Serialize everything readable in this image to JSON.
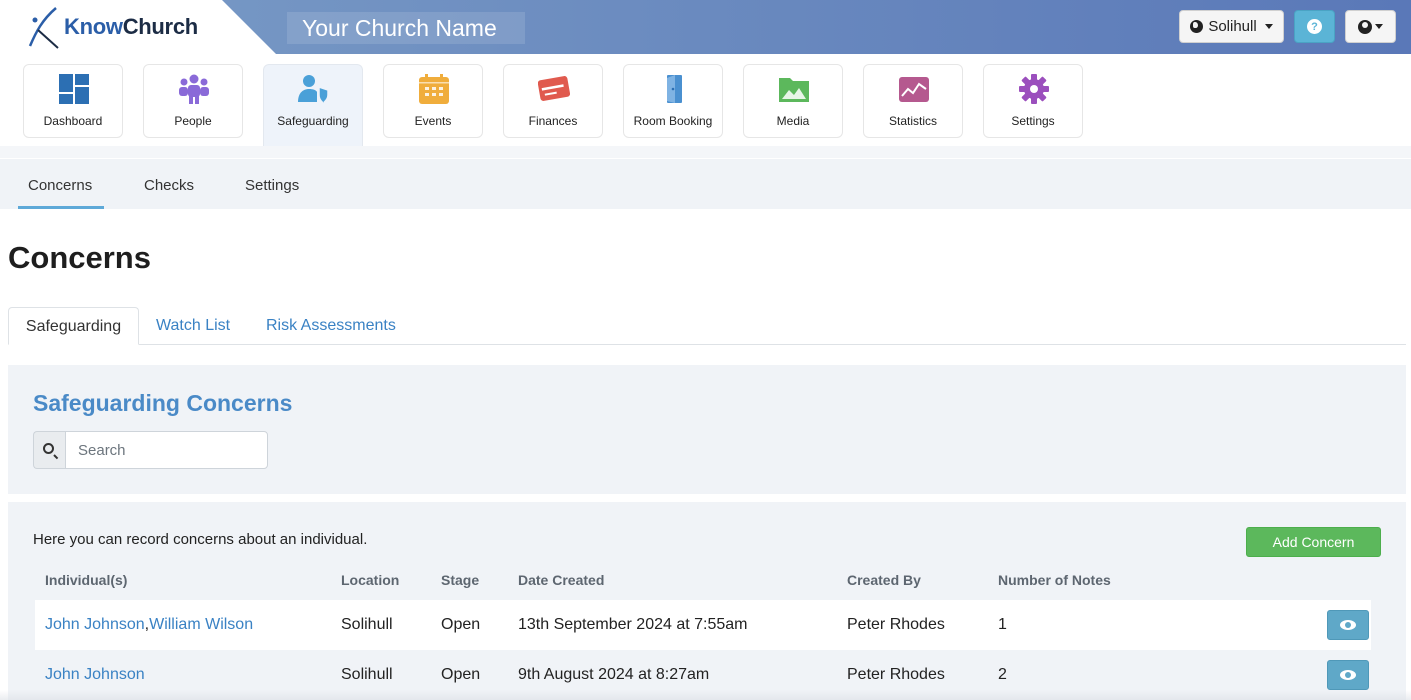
{
  "app": {
    "logo": {
      "i": "i",
      "know": "Know",
      "church": "Church"
    },
    "church_name": "Your Church Name"
  },
  "header": {
    "location_label": "Solihull",
    "help_label": "?",
    "icons": {
      "location": "globe-icon",
      "help": "question-icon",
      "user": "user-circle-icon"
    }
  },
  "modules": [
    {
      "label": "Dashboard",
      "icon": "dashboard-icon",
      "color": "#2c6fb3"
    },
    {
      "label": "People",
      "icon": "people-icon",
      "color": "#8a6ad8"
    },
    {
      "label": "Safeguarding",
      "icon": "safeguarding-icon",
      "color": "#4aa0d8",
      "active": true
    },
    {
      "label": "Events",
      "icon": "calendar-icon",
      "color": "#f0ad3c"
    },
    {
      "label": "Finances",
      "icon": "credit-card-icon",
      "color": "#e05a4e"
    },
    {
      "label": "Room Booking",
      "icon": "door-icon",
      "color": "#4a90d0"
    },
    {
      "label": "Media",
      "icon": "folder-image-icon",
      "color": "#5cb85c"
    },
    {
      "label": "Statistics",
      "icon": "chart-line-icon",
      "color": "#b5598f"
    },
    {
      "label": "Settings",
      "icon": "gear-icon",
      "color": "#9b4fbd"
    }
  ],
  "subnav": {
    "items": [
      {
        "label": "Concerns",
        "active": true
      },
      {
        "label": "Checks"
      },
      {
        "label": "Settings"
      }
    ]
  },
  "page": {
    "title": "Concerns",
    "tabs": [
      {
        "label": "Safeguarding",
        "active": true
      },
      {
        "label": "Watch List"
      },
      {
        "label": "Risk Assessments"
      }
    ]
  },
  "safeguarding": {
    "title": "Safeguarding Concerns",
    "search_placeholder": "Search",
    "intro": "Here you can record concerns about an individual.",
    "add_button": "Add Concern",
    "columns": [
      "Individual(s)",
      "Location",
      "Stage",
      "Date Created",
      "Created By",
      "Number of Notes"
    ],
    "rows": [
      {
        "individuals": [
          "John Johnson",
          "William Wilson"
        ],
        "location": "Solihull",
        "stage": "Open",
        "date_created": "13th September 2024 at 7:55am",
        "created_by": "Peter Rhodes",
        "notes": "1"
      },
      {
        "individuals": [
          "John Johnson"
        ],
        "location": "Solihull",
        "stage": "Open",
        "date_created": "9th August 2024 at 8:27am",
        "created_by": "Peter Rhodes",
        "notes": "2"
      }
    ]
  },
  "colors": {
    "header_start": "#7a9cc6",
    "header_end": "#5a78b8",
    "link": "#3a82c4",
    "panel_title": "#4a8ac7",
    "success": "#5cb85c",
    "info": "#5fa8c8"
  }
}
